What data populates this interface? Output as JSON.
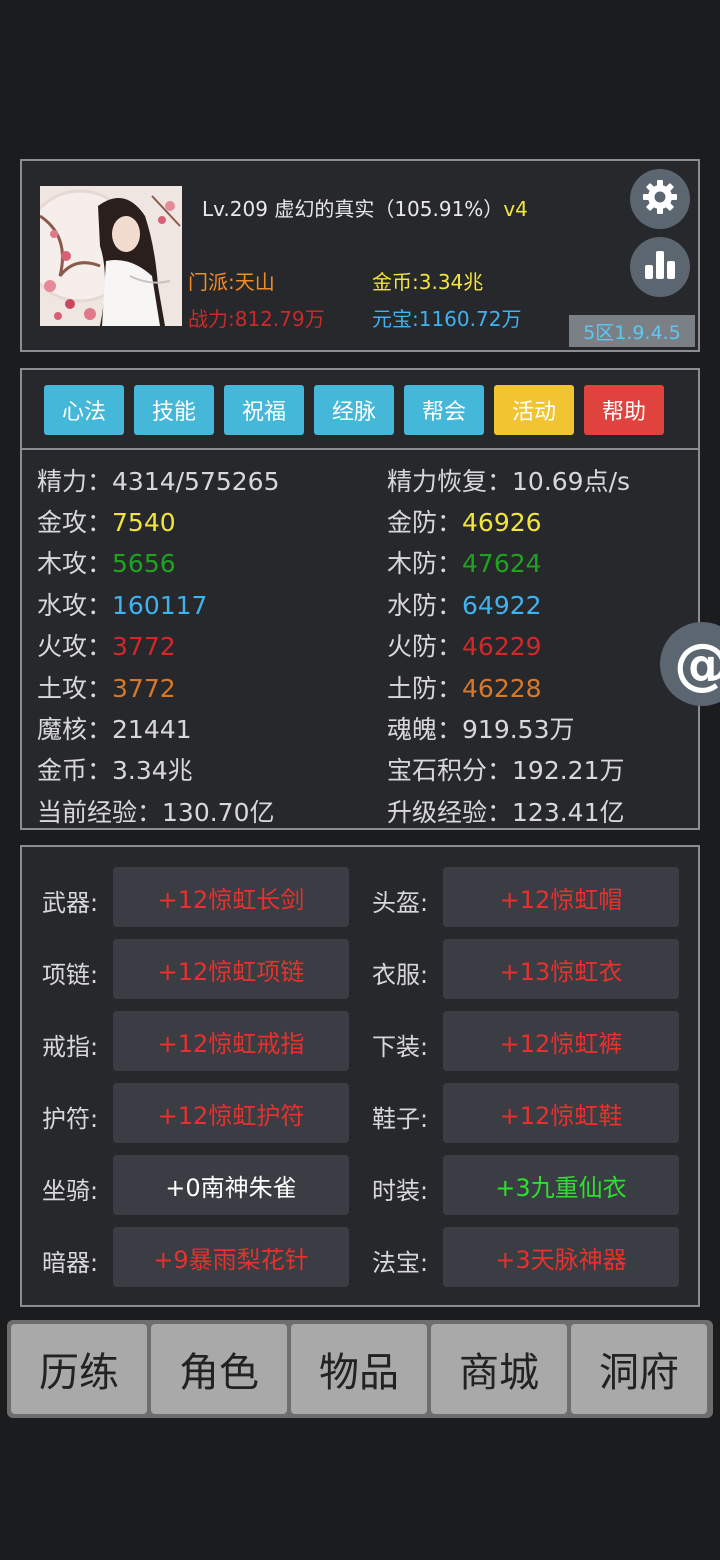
{
  "header": {
    "title": "Lv.209 虚幻的真实（105.91%）",
    "version": "v4",
    "sect": "门派:天山",
    "combat_power": "战力:812.79万",
    "gold": "金币:3.34兆",
    "ingot": "元宝:1160.72万",
    "server": "5区1.9.4.5"
  },
  "tabs": [
    {
      "label": "心法",
      "color": "#45b7d8"
    },
    {
      "label": "技能",
      "color": "#45b7d8"
    },
    {
      "label": "祝福",
      "color": "#45b7d8"
    },
    {
      "label": "经脉",
      "color": "#45b7d8"
    },
    {
      "label": "帮会",
      "color": "#45b7d8"
    },
    {
      "label": "活动",
      "color": "#f0c531"
    },
    {
      "label": "帮助",
      "color": "#e0433d"
    }
  ],
  "stats": {
    "left": [
      {
        "label": "精力：",
        "value": "4314/575265",
        "color": "#d8d8d8"
      },
      {
        "label": "金攻：",
        "value": "7540",
        "color": "#f2e53c"
      },
      {
        "label": "木攻：",
        "value": "5656",
        "color": "#1fa31f"
      },
      {
        "label": "水攻：",
        "value": "160117",
        "color": "#3fb3f0"
      },
      {
        "label": "火攻：",
        "value": "3772",
        "color": "#d12828"
      },
      {
        "label": "土攻：",
        "value": "3772",
        "color": "#d9782a"
      },
      {
        "label": "魔核：",
        "value": "21441",
        "color": "#d8d8d8"
      },
      {
        "label": "金币：",
        "value": "3.34兆",
        "color": "#d8d8d8"
      },
      {
        "label": "当前经验：",
        "value": "130.70亿",
        "color": "#d8d8d8"
      }
    ],
    "right": [
      {
        "label": "精力恢复：",
        "value": "10.69点/s",
        "color": "#d8d8d8"
      },
      {
        "label": "金防：",
        "value": "46926",
        "color": "#f2e53c"
      },
      {
        "label": "木防：",
        "value": "47624",
        "color": "#1fa31f"
      },
      {
        "label": "水防：",
        "value": "64922",
        "color": "#3fb3f0"
      },
      {
        "label": "火防：",
        "value": "46229",
        "color": "#d12828"
      },
      {
        "label": "土防：",
        "value": "46228",
        "color": "#d9782a"
      },
      {
        "label": "魂魄：",
        "value": "919.53万",
        "color": "#d8d8d8"
      },
      {
        "label": "宝石积分：",
        "value": "192.21万",
        "color": "#d8d8d8"
      },
      {
        "label": "升级经验：",
        "value": "123.41亿",
        "color": "#d8d8d8"
      }
    ]
  },
  "equipment": [
    {
      "slot": "武器:",
      "item": "+12惊虹长剑",
      "color": "#e8302c"
    },
    {
      "slot": "头盔:",
      "item": "+12惊虹帽",
      "color": "#e8302c"
    },
    {
      "slot": "项链:",
      "item": "+12惊虹项链",
      "color": "#e8302c"
    },
    {
      "slot": "衣服:",
      "item": "+13惊虹衣",
      "color": "#e8302c"
    },
    {
      "slot": "戒指:",
      "item": "+12惊虹戒指",
      "color": "#e8302c"
    },
    {
      "slot": "下装:",
      "item": "+12惊虹裤",
      "color": "#e8302c"
    },
    {
      "slot": "护符:",
      "item": "+12惊虹护符",
      "color": "#e8302c"
    },
    {
      "slot": "鞋子:",
      "item": "+12惊虹鞋",
      "color": "#e8302c"
    },
    {
      "slot": "坐骑:",
      "item": "+0南神朱雀",
      "color": "#ffffff"
    },
    {
      "slot": "时装:",
      "item": "+3九重仙衣",
      "color": "#2ee02e"
    },
    {
      "slot": "暗器:",
      "item": "+9暴雨梨花针",
      "color": "#e8302c"
    },
    {
      "slot": "法宝:",
      "item": "+3天脉神器",
      "color": "#e8302c"
    }
  ],
  "nav": [
    "历练",
    "角色",
    "物品",
    "商城",
    "洞府"
  ],
  "float_button": "@"
}
